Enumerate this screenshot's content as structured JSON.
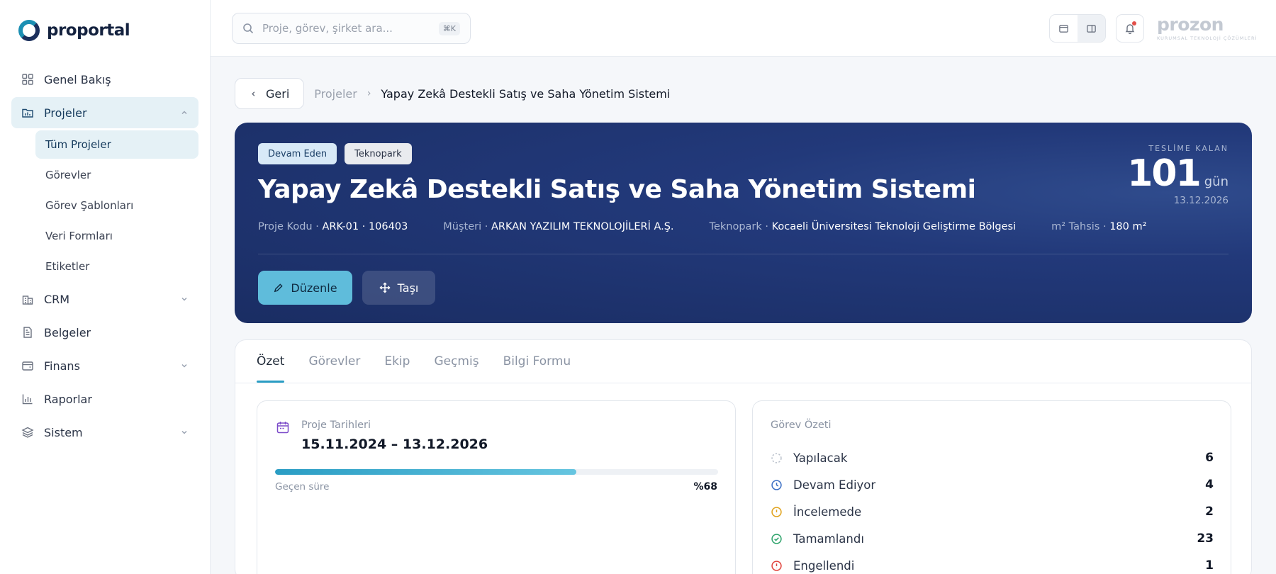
{
  "app": {
    "logo_text": "proportal"
  },
  "sidebar": {
    "items": [
      {
        "label": "Genel Bakış"
      },
      {
        "label": "Projeler"
      },
      {
        "label": "CRM"
      },
      {
        "label": "Belgeler"
      },
      {
        "label": "Finans"
      },
      {
        "label": "Raporlar"
      },
      {
        "label": "Sistem"
      }
    ],
    "projects_sub": [
      {
        "label": "Tüm Projeler"
      },
      {
        "label": "Görevler"
      },
      {
        "label": "Görev Şablonları"
      },
      {
        "label": "Veri Formları"
      },
      {
        "label": "Etiketler"
      }
    ]
  },
  "topbar": {
    "search_placeholder": "Proje, görev, şirket ara...",
    "search_shortcut": "⌘K",
    "brand_name": "prozon",
    "brand_tagline": "KURUMSAL TEKNOLOJİ ÇÖZÜMLERİ"
  },
  "breadcrumb": {
    "back_label": "Geri",
    "parent": "Projeler",
    "separator": "›",
    "current": "Yapay Zekâ Destekli Satış ve Saha Yönetim Sistemi"
  },
  "hero": {
    "status_badge": "Devam Eden",
    "type_badge": "Teknopark",
    "title": "Yapay Zekâ Destekli Satış ve Saha Yönetim Sistemi",
    "meta": [
      {
        "key": "Proje Kodu · ",
        "value": "ARK-01 · 106403"
      },
      {
        "key": "Müşteri · ",
        "value": "ARKAN YAZILIM TEKNOLOJİLERİ A.Ş."
      },
      {
        "key": "Teknopark · ",
        "value": "Kocaeli Üniversitesi Teknoloji Geliştirme Bölgesi"
      },
      {
        "key": "m² Tahsis · ",
        "value": "180 m²"
      }
    ],
    "edit_label": "Düzenle",
    "move_label": "Taşı",
    "deadline_label": "TESLİME KALAN",
    "deadline_days": "101",
    "deadline_unit": "gün",
    "deadline_date": "13.12.2026"
  },
  "tabs": [
    {
      "label": "Özet"
    },
    {
      "label": "Görevler"
    },
    {
      "label": "Ekip"
    },
    {
      "label": "Geçmiş"
    },
    {
      "label": "Bilgi Formu"
    }
  ],
  "dates_panel": {
    "label": "Proje Tarihleri",
    "range": "15.11.2024 – 13.12.2026",
    "elapsed_label": "Geçen süre",
    "elapsed_pct_text": "%68",
    "elapsed_fraction": 0.68
  },
  "tasks_panel": {
    "label": "Görev Özeti",
    "rows": [
      {
        "name": "Yapılacak",
        "count": "6",
        "color": "#b9c0cb"
      },
      {
        "name": "Devam Ediyor",
        "count": "4",
        "color": "#3b6fc4"
      },
      {
        "name": "İncelemede",
        "count": "2",
        "color": "#e0a21b"
      },
      {
        "name": "Tamamlandı",
        "count": "23",
        "color": "#2ea36b"
      },
      {
        "name": "Engellendi",
        "count": "1",
        "color": "#e0433c"
      }
    ]
  },
  "colors": {
    "accent": "#2a9dc4",
    "hero_bg": "#1f3470",
    "edit_button": "#5fbcdb"
  }
}
